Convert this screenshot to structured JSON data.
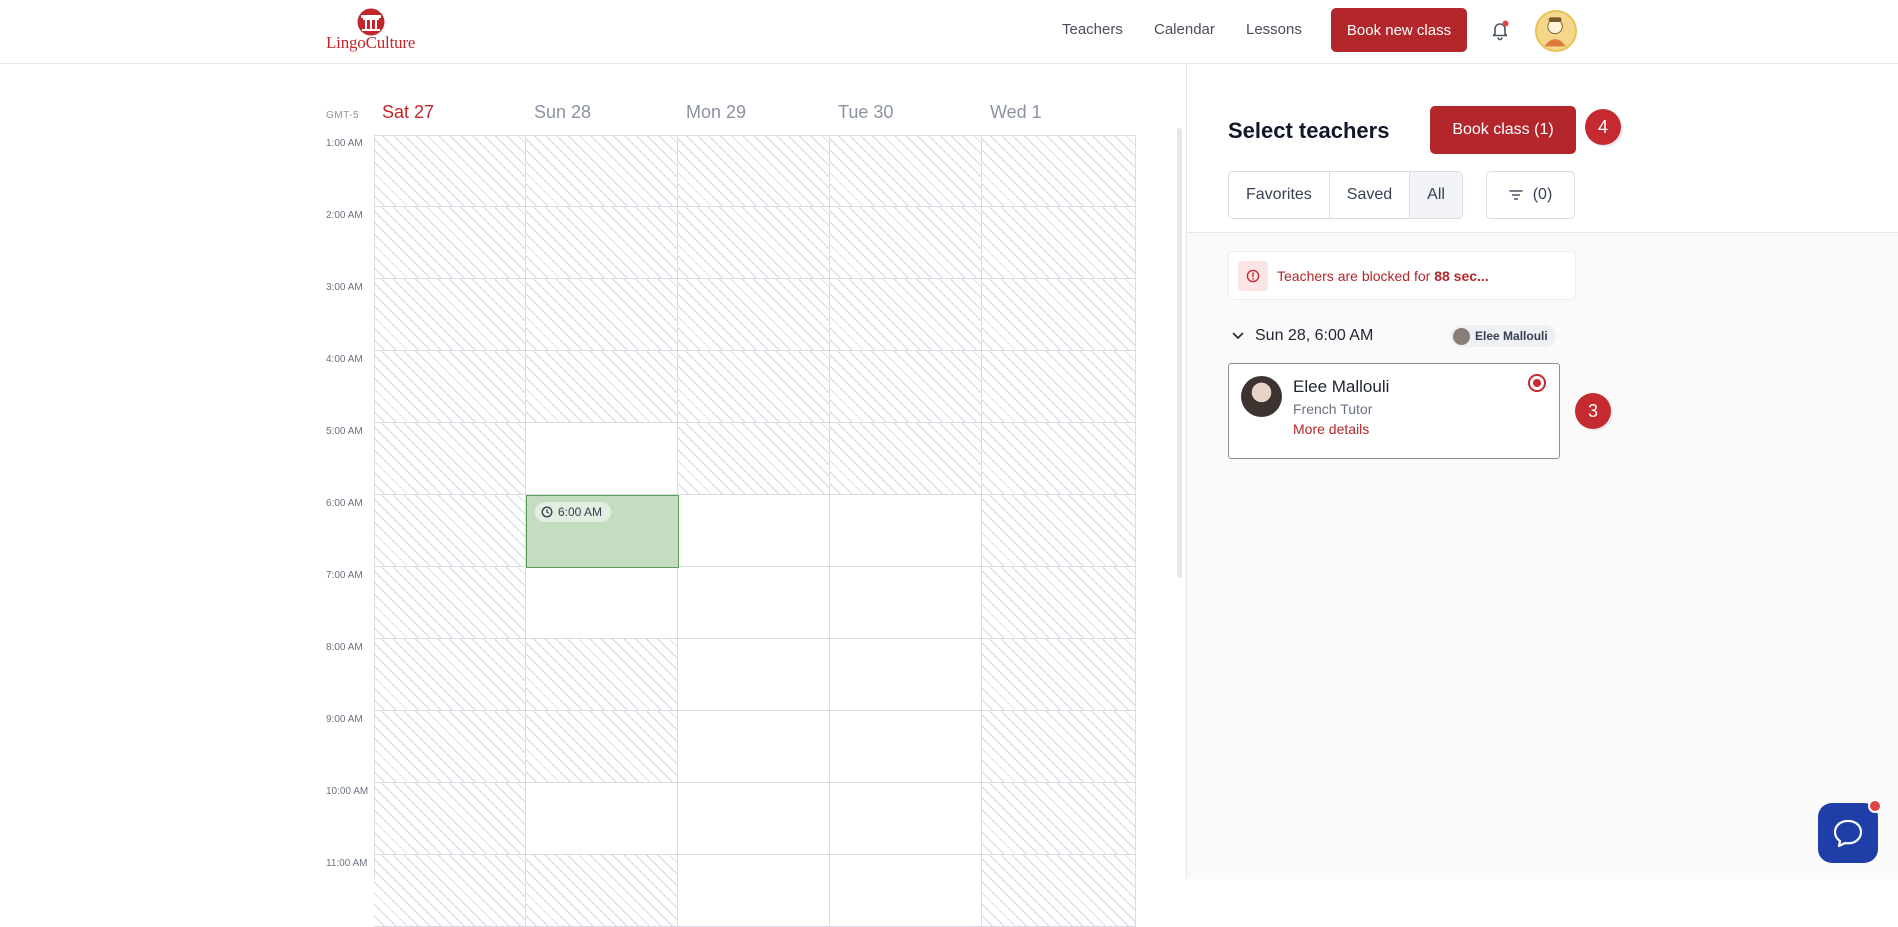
{
  "brand": {
    "name": "LingoCulture",
    "color": "#c0262c"
  },
  "nav": {
    "teachers": "Teachers",
    "calendar": "Calendar",
    "lessons": "Lessons",
    "book_new": "Book new class"
  },
  "calendar": {
    "timezone": "GMT-5",
    "days": [
      {
        "label": "Sat 27",
        "today": true
      },
      {
        "label": "Sun 28",
        "today": false
      },
      {
        "label": "Mon 29",
        "today": false
      },
      {
        "label": "Tue 30",
        "today": false
      },
      {
        "label": "Wed 1",
        "today": false
      }
    ],
    "times": [
      "1:00 AM",
      "2:00 AM",
      "3:00 AM",
      "4:00 AM",
      "5:00 AM",
      "6:00 AM",
      "7:00 AM",
      "8:00 AM",
      "9:00 AM",
      "10:00 AM",
      "11:00 AM"
    ],
    "availability": [
      [
        1,
        1,
        1,
        1,
        1
      ],
      [
        1,
        1,
        1,
        1,
        1
      ],
      [
        1,
        1,
        1,
        1,
        1
      ],
      [
        1,
        1,
        1,
        1,
        1
      ],
      [
        1,
        0,
        1,
        1,
        1
      ],
      [
        1,
        0,
        0,
        0,
        1
      ],
      [
        1,
        0,
        0,
        0,
        1
      ],
      [
        1,
        1,
        0,
        0,
        1
      ],
      [
        1,
        1,
        0,
        0,
        1
      ],
      [
        1,
        0,
        0,
        0,
        1
      ],
      [
        1,
        1,
        0,
        0,
        1
      ]
    ],
    "selected_slot": {
      "day": "Sun 28",
      "time": "6:00 AM",
      "label": "6:00 AM"
    }
  },
  "panel": {
    "title": "Select teachers",
    "book_button": "Book class (1)",
    "step_badge_book": "4",
    "filters": [
      "Favorites",
      "Saved",
      "All"
    ],
    "filter_count": "(0)",
    "alert_prefix": "Teachers are blocked for ",
    "alert_time": "88 sec...",
    "slot_label": "Sun 28, 6:00 AM",
    "slot_teacher_chip": "Elee Mallouli",
    "teacher": {
      "name": "Elee Mallouli",
      "role": "French Tutor",
      "more": "More details"
    },
    "step_badge_teacher": "3"
  }
}
